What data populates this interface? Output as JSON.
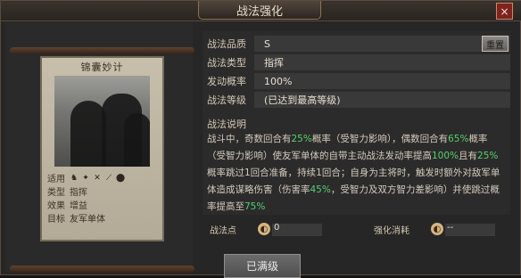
{
  "dialog": {
    "title": "战法强化",
    "close_icon": "close-icon"
  },
  "card": {
    "name": "锦囊妙计",
    "attrs": [
      {
        "label": "适用",
        "value": ""
      },
      {
        "label": "类型",
        "value": "指挥"
      },
      {
        "label": "效果",
        "value": "增益"
      },
      {
        "label": "目标",
        "value": "友军单体"
      }
    ],
    "icons": [
      "horse-icon",
      "sword-icon",
      "bow-icon",
      "spear-icon",
      "shield-icon"
    ]
  },
  "info": {
    "quality_label": "战法品质",
    "quality_value": "S",
    "reset_label": "重置",
    "type_label": "战法类型",
    "type_value": "指挥",
    "rate_label": "发动概率",
    "rate_value": "100%",
    "level_label": "战法等级",
    "level_value": "(已达到最高等级)",
    "desc_label": "战法说明",
    "desc_parts": [
      "战斗中，奇数回合有",
      "25%",
      "概率（受智力影响），偶数回合有",
      "65%",
      "概率（受智力影响）使友军单体的自带主动战法发动率提高",
      "100%",
      "且有",
      "25%",
      "概率跳过1回合准备，持续1回合；自身为主将时，触发时额外对敌军单体造成谋略伤害（伤害率",
      "45%",
      "，受智力及双方智力差影响）并使跳过概率提高至",
      "75%"
    ]
  },
  "footer": {
    "points_label": "战法点",
    "points_value": "0",
    "cost_label": "强化消耗",
    "cost_value": "--"
  },
  "actions": {
    "full_label": "已满级"
  }
}
